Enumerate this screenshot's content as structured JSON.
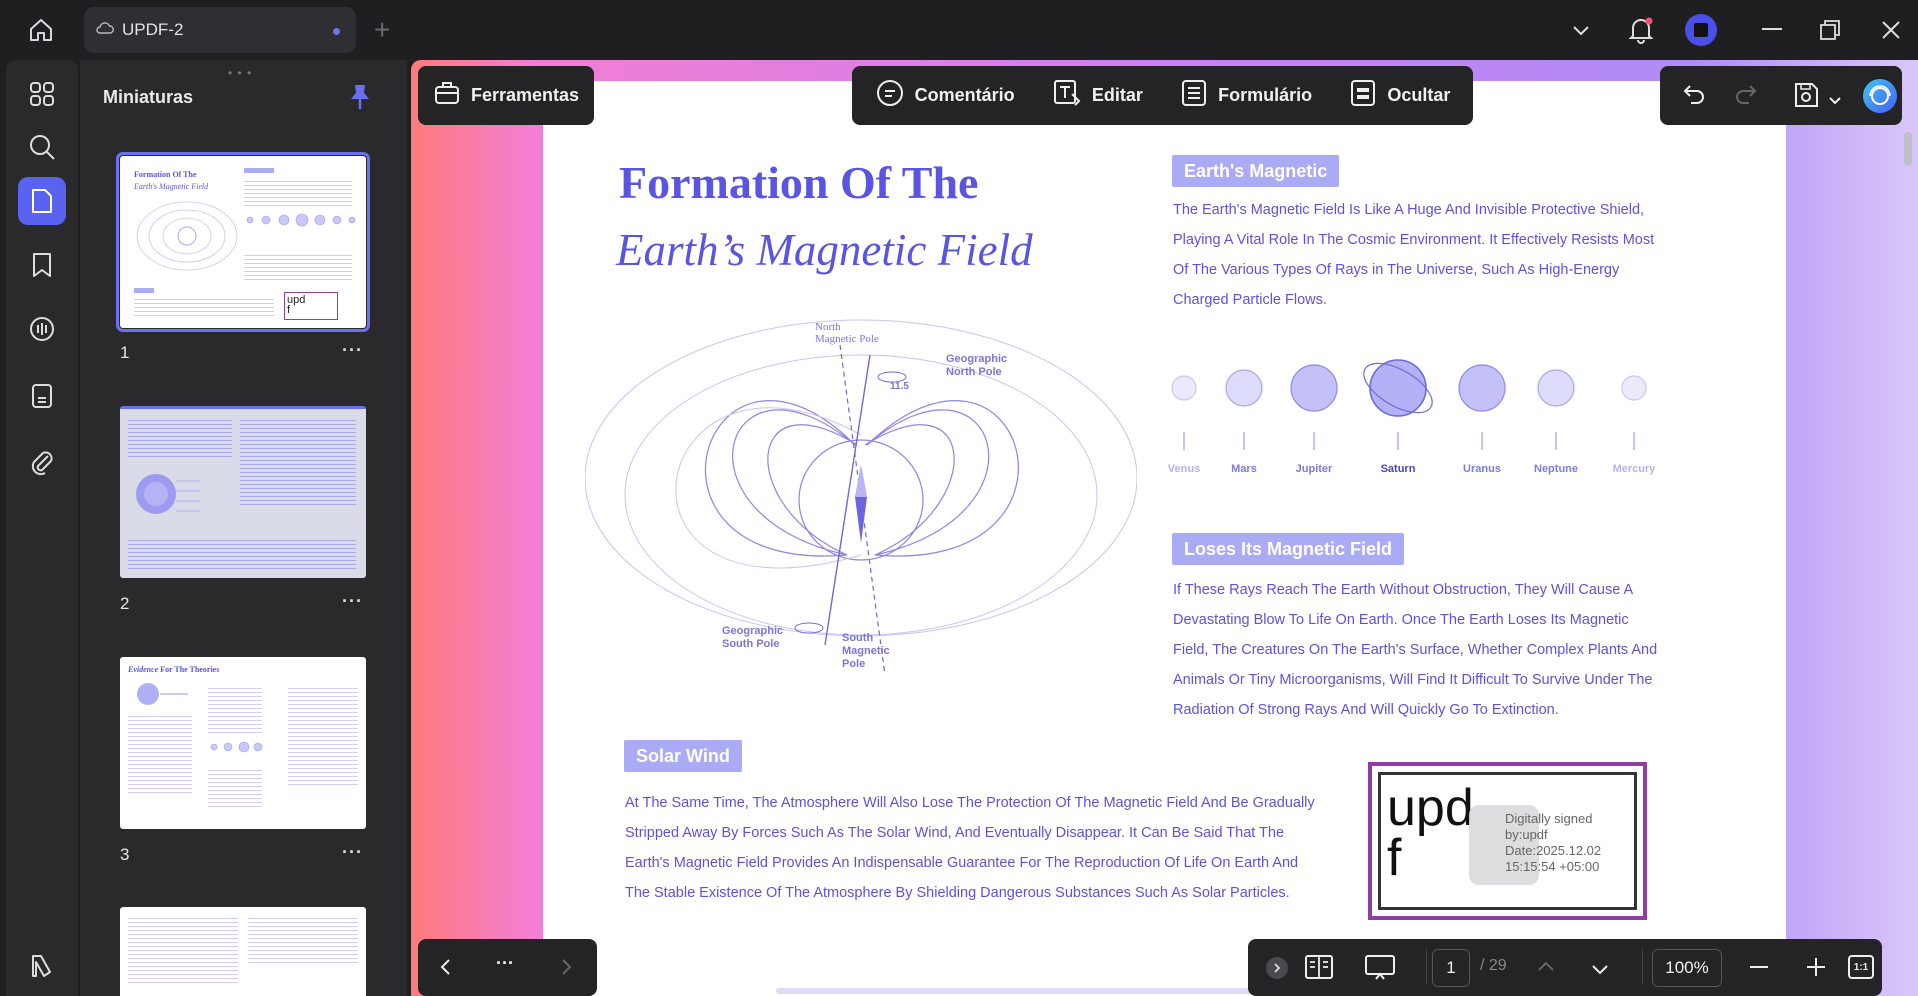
{
  "titlebar": {
    "tab_title": "UPDF-2",
    "new_tab": "+"
  },
  "thumbnails": {
    "title": "Miniaturas",
    "pages": [
      {
        "number": "1",
        "more": "···"
      },
      {
        "number": "2",
        "more": "···"
      },
      {
        "number": "3",
        "more": "···"
      }
    ],
    "thumb1_title": "Formation Of The",
    "thumb1_subtitle": "Earth's Magnetic Field",
    "thumb1_sig": "upd",
    "thumb1_sig2": "f",
    "thumb3_title_italic": "Evidence",
    "thumb3_title": "For The Theories"
  },
  "toolbar": {
    "ferramentas": "Ferramentas",
    "comentario": "Comentário",
    "editar": "Editar",
    "formulario": "Formulário",
    "ocultar": "Ocultar"
  },
  "document": {
    "title_line1": "Formation Of The",
    "title_line2": "Earth’s Magnetic Field",
    "diagram": {
      "north_magnetic": [
        "North",
        "Magnetic Pole"
      ],
      "geo_north": [
        "Geographic",
        "North Pole"
      ],
      "angle": "11.5",
      "geo_south": [
        "Geographic",
        "South Pole"
      ],
      "south_magnetic": [
        "South",
        "Magnetic",
        "Pole"
      ]
    },
    "section1_title": "Earth's Magnetic",
    "section1_lines": [
      "The Earth's Magnetic Field Is Like A Huge And Invisible Protective Shield,",
      "Playing A Vital Role In The Cosmic Environment. It Effectively Resists Most",
      "Of The Various Types Of Rays in The Universe, Such As High-Energy",
      "Charged Particle Flows."
    ],
    "planets": [
      "Venus",
      "Mars",
      "Jupiter",
      "Saturn",
      "Uranus",
      "Neptune",
      "Mercury"
    ],
    "section2_title": "Loses Its Magnetic Field",
    "section2_lines": [
      "If These Rays Reach The Earth Without Obstruction, They Will Cause A",
      "Devastating Blow To Life On Earth. Once The Earth Loses Its Magnetic",
      "Field, The Creatures On The Earth's Surface, Whether Complex Plants And",
      "Animals Or Tiny Microorganisms, Will Find It Difficult To Survive Under The",
      "Radiation Of Strong Rays And Will Quickly Go To Extinction."
    ],
    "section3_title": "Solar Wind",
    "section3_lines": [
      "At The Same Time, The Atmosphere Will Also Lose The Protection Of The Magnetic Field And Be Gradually",
      "Stripped Away By Forces Such As The Solar Wind, And Eventually Disappear. It Can Be Said That The",
      "Earth's Magnetic Field Provides An Indispensable Guarantee For The Reproduction Of Life On Earth And",
      "The Stable Existence Of The Atmosphere By Shielding Dangerous Substances Such As Solar Particles."
    ],
    "signature": {
      "big1": "upd",
      "big2": "f",
      "lines": [
        "Digitally signed",
        "by:updf",
        "Date:2025.12.02",
        "15:15:54 +05:00"
      ]
    }
  },
  "bottom": {
    "more": "···",
    "page_current": "1",
    "page_total": "/ 29",
    "zoom": "100%",
    "ratio": "1:1"
  }
}
